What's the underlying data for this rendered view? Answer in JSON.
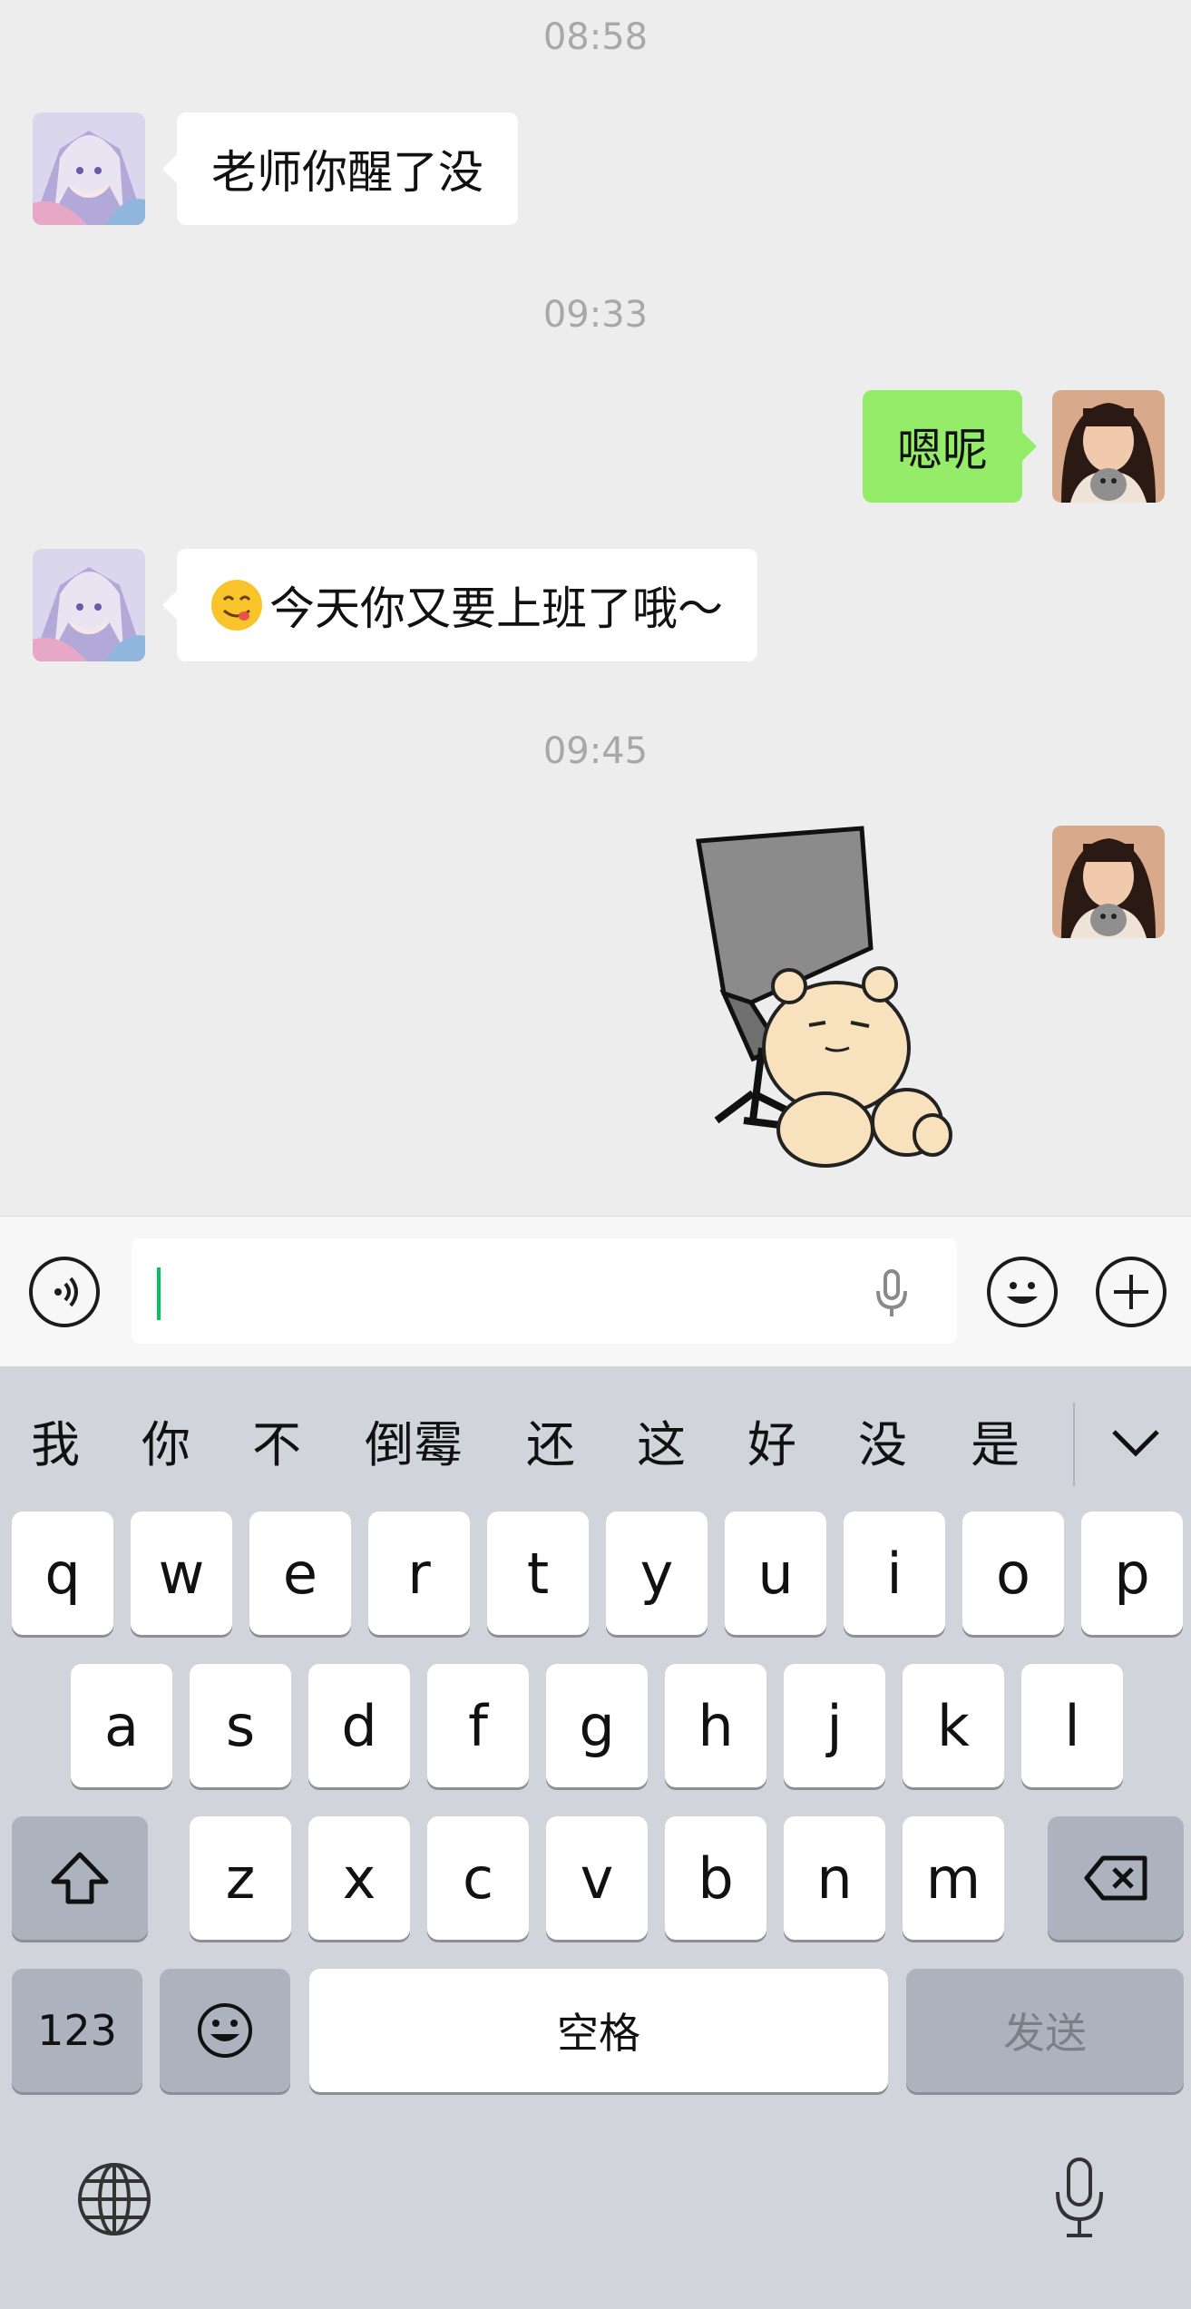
{
  "chat": {
    "messages": [
      {
        "type": "time",
        "text": "08:58"
      },
      {
        "type": "in",
        "text": "老师你醒了没"
      },
      {
        "type": "time",
        "text": "09:33"
      },
      {
        "type": "out",
        "text": "嗯呢"
      },
      {
        "type": "in",
        "emoji": "yum-emoji",
        "text": "今天你又要上班了哦～"
      },
      {
        "type": "time",
        "text": "09:45"
      },
      {
        "type": "out-sticker",
        "sticker": "bear-with-chair-sticker"
      }
    ]
  },
  "input": {
    "value": ""
  },
  "keyboard": {
    "candidates": [
      "我",
      "你",
      "不",
      "倒霉",
      "还",
      "这",
      "好",
      "没",
      "是"
    ],
    "row1": [
      "q",
      "w",
      "e",
      "r",
      "t",
      "y",
      "u",
      "i",
      "o",
      "p"
    ],
    "row2": [
      "a",
      "s",
      "d",
      "f",
      "g",
      "h",
      "j",
      "k",
      "l"
    ],
    "row3": [
      "z",
      "x",
      "c",
      "v",
      "b",
      "n",
      "m"
    ],
    "num_label": "123",
    "space_label": "空格",
    "send_label": "发送"
  },
  "colors": {
    "out_bubble": "#95ec69",
    "caret": "#07c160",
    "keyboard_bg": "#d1d4db"
  }
}
